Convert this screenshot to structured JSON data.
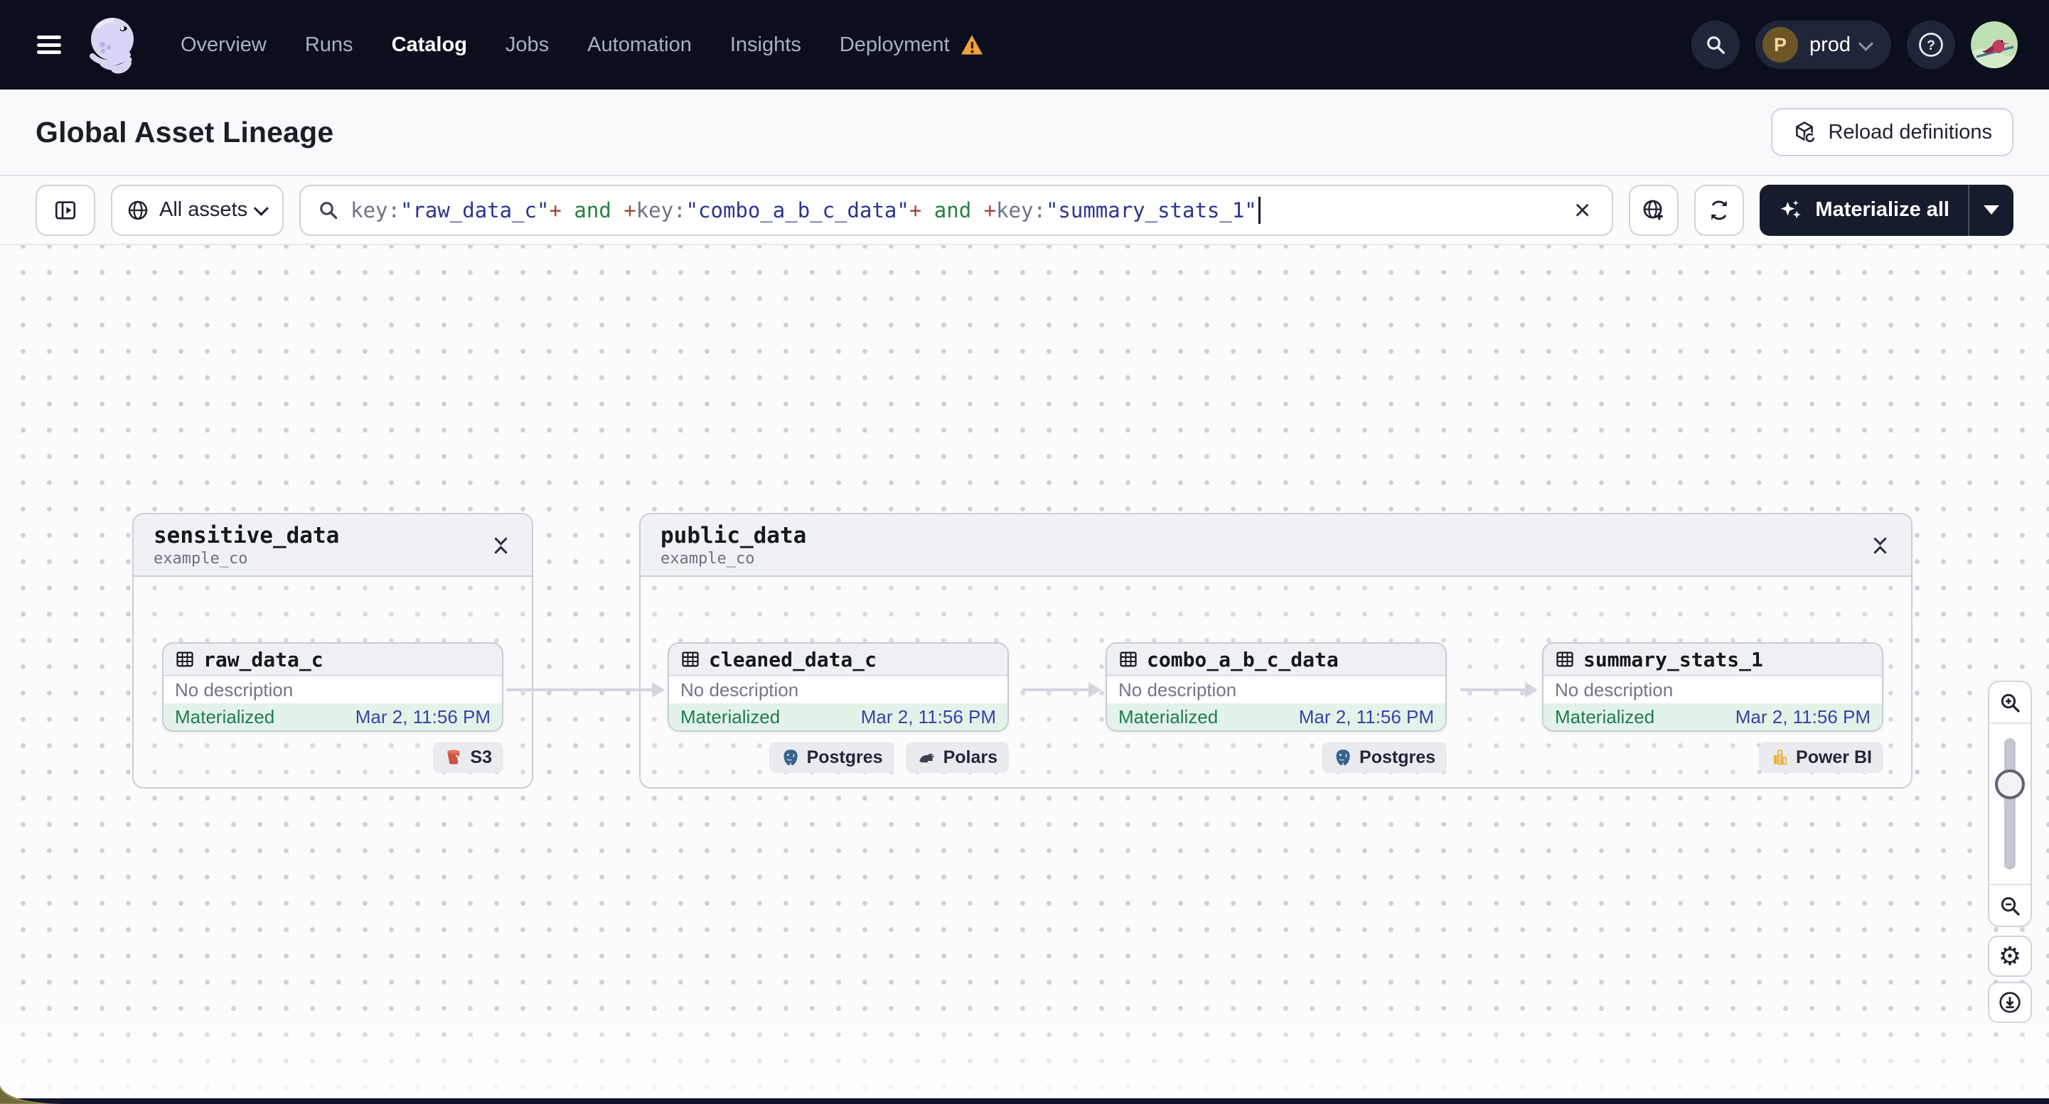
{
  "navbar": {
    "links": [
      {
        "label": "Overview"
      },
      {
        "label": "Runs"
      },
      {
        "label": "Catalog",
        "active": true
      },
      {
        "label": "Jobs"
      },
      {
        "label": "Automation"
      },
      {
        "label": "Insights"
      },
      {
        "label": "Deployment",
        "warning": true
      }
    ],
    "environment": {
      "initial": "P",
      "name": "prod"
    }
  },
  "header": {
    "title": "Global Asset Lineage",
    "reload_button": {
      "label": "Reload definitions",
      "icon": "cube-reload-icon"
    }
  },
  "toolbar": {
    "asset_scope": {
      "label": "All assets",
      "icon": "globe-icon"
    },
    "search": {
      "tokens": [
        {
          "text": "key:",
          "type": "field"
        },
        {
          "text": "\"raw_data_c\"",
          "type": "value"
        },
        {
          "text": "+",
          "type": "op"
        },
        {
          "text": " and ",
          "type": "logic"
        },
        {
          "text": "+",
          "type": "op"
        },
        {
          "text": "key:",
          "type": "field"
        },
        {
          "text": "\"combo_a_b_c_data\"",
          "type": "value"
        },
        {
          "text": "+",
          "type": "op"
        },
        {
          "text": " and ",
          "type": "logic"
        },
        {
          "text": "+",
          "type": "op"
        },
        {
          "text": "key:",
          "type": "field"
        },
        {
          "text": "\"summary_stats_1\"",
          "type": "value"
        }
      ],
      "clear": "×"
    },
    "materialize": {
      "label": "Materialize all",
      "icon": "sparkle-icon"
    }
  },
  "graph": {
    "groups": [
      {
        "name": "sensitive_data",
        "location": "example_co",
        "assets": [
          {
            "name": "raw_data_c",
            "description": "No description",
            "status": "Materialized",
            "timestamp": "Mar 2, 11:56 PM",
            "tags": [
              {
                "label": "S3",
                "icon": "s3-bucket-icon"
              }
            ]
          }
        ]
      },
      {
        "name": "public_data",
        "location": "example_co",
        "assets": [
          {
            "name": "cleaned_data_c",
            "description": "No description",
            "status": "Materialized",
            "timestamp": "Mar 2, 11:56 PM",
            "tags": [
              {
                "label": "Postgres",
                "icon": "postgres-icon"
              },
              {
                "label": "Polars",
                "icon": "polars-icon"
              }
            ]
          },
          {
            "name": "combo_a_b_c_data",
            "description": "No description",
            "status": "Materialized",
            "timestamp": "Mar 2, 11:56 PM",
            "tags": [
              {
                "label": "Postgres",
                "icon": "postgres-icon"
              }
            ]
          },
          {
            "name": "summary_stats_1",
            "description": "No description",
            "status": "Materialized",
            "timestamp": "Mar 2, 11:56 PM",
            "tags": [
              {
                "label": "Power BI",
                "icon": "powerbi-icon"
              }
            ]
          }
        ]
      }
    ]
  },
  "colors": {
    "nav_background": "#0b0e1d",
    "materialized_green": "#1d7d4f",
    "status_row_green": "#e4f3e9",
    "timestamp_indigo": "#3a41a8",
    "warning_amber": "#f0a33c",
    "query_field": "#6b7486",
    "query_value": "#2b3590",
    "query_operator": "#9c4a3f",
    "query_logic": "#27803f"
  }
}
